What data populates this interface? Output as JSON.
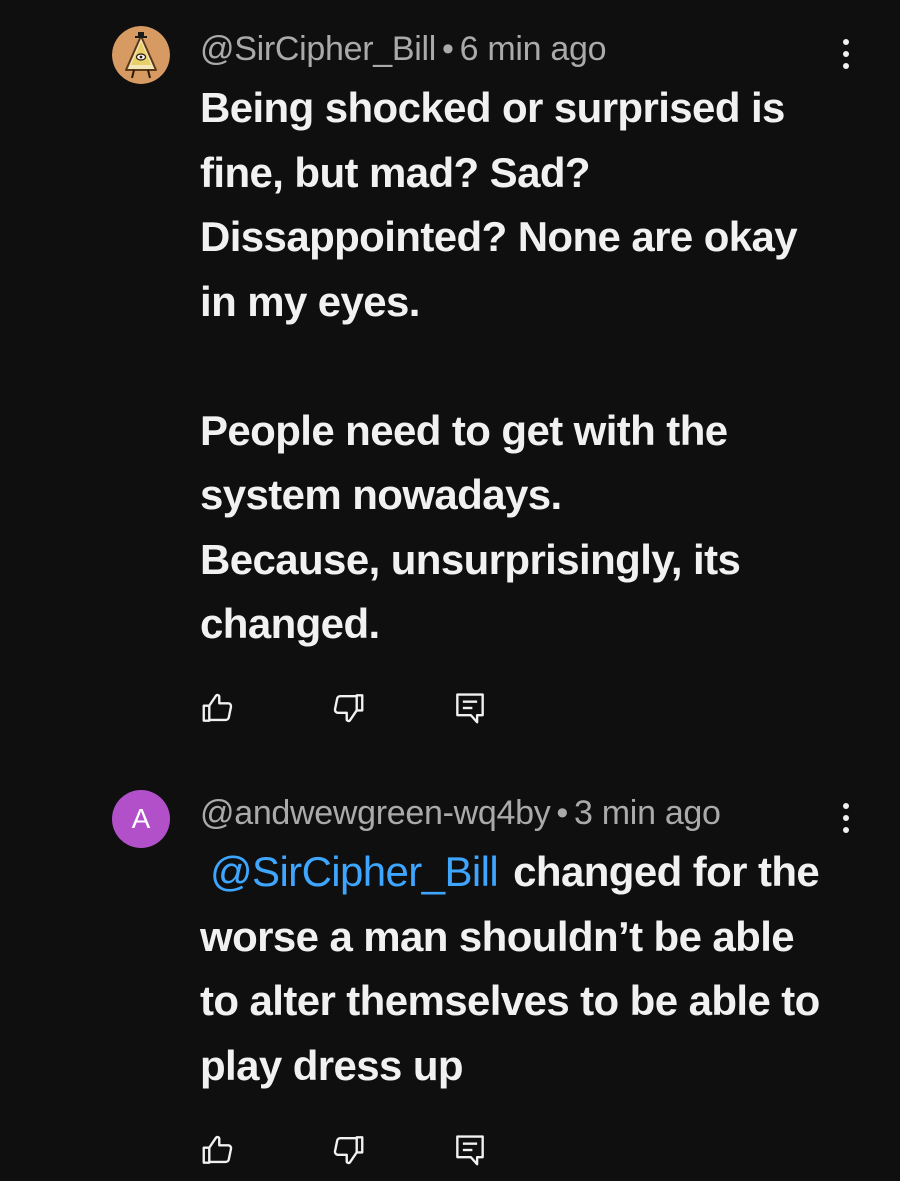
{
  "comments": [
    {
      "username": "@SirCipher_Bill",
      "separator": "•",
      "time": "6 min ago",
      "avatar_icon": "bill-cipher-avatar-icon",
      "paragraphs": [
        "Being shocked or surprised is fine, but mad? Sad? Dissappointed? None are okay in my eyes.",
        "",
        "People need to get with the system nowadays.",
        "Because, unsurprisingly, its changed."
      ],
      "actions": [
        "like-icon",
        "dislike-icon",
        "reply-icon"
      ]
    },
    {
      "username": "@andwewgreen-wq4by",
      "separator": "•",
      "time": "3 min ago",
      "avatar_letter": "A",
      "avatar_color": "#b150c9",
      "mention": "@SirCipher_Bill",
      "text": "changed for the worse a man shouldn’t be able to alter themselves to be able to play dress up",
      "actions": [
        "like-icon",
        "dislike-icon",
        "reply-icon"
      ]
    }
  ],
  "colors": {
    "background": "#0f0f0f",
    "text": "#f1f1f1",
    "meta": "#aaaaaa",
    "mention": "#3ea6ff"
  }
}
